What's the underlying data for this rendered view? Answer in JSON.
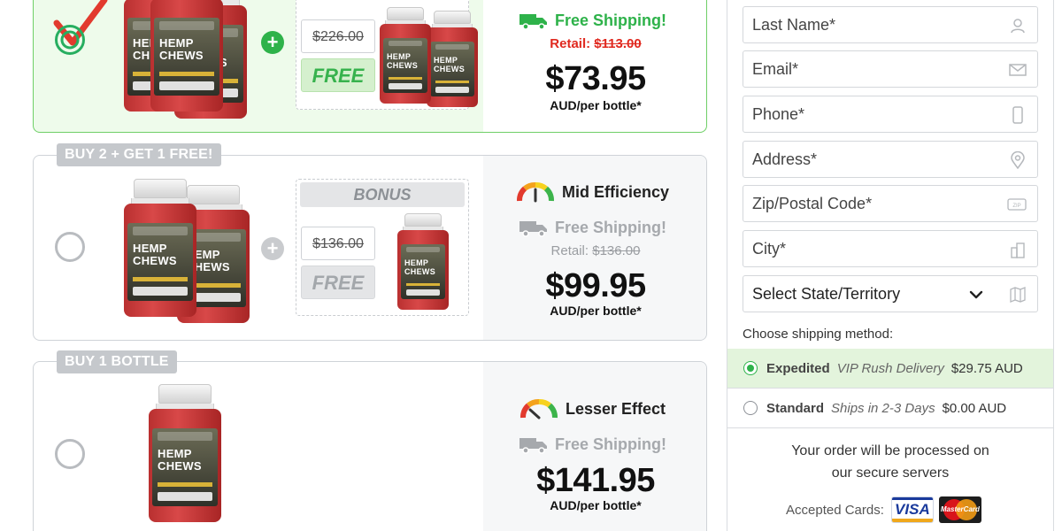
{
  "offers": [
    {
      "label": "",
      "selected": true,
      "bottle_name": "HEMP\nCHEWS",
      "bonus_header": "",
      "old_bonus_price": "$226.00",
      "free_label": "FREE",
      "efficiency": "",
      "shipping": "Free Shipping!",
      "retail_prefix": "Retail:",
      "retail_price": "$113.00",
      "price": "$73.95",
      "per": "AUD/per bottle*"
    },
    {
      "label": "BUY 2 + GET 1 FREE!",
      "selected": false,
      "bottle_name": "HEMP\nCHEWS",
      "bonus_header": "BONUS",
      "old_bonus_price": "$136.00",
      "free_label": "FREE",
      "efficiency": "Mid Efficiency",
      "shipping": "Free Shipping!",
      "retail_prefix": "Retail:",
      "retail_price": "$136.00",
      "price": "$99.95",
      "per": "AUD/per bottle*"
    },
    {
      "label": "BUY 1 BOTTLE",
      "selected": false,
      "bottle_name": "HEMP\nCHEWS",
      "efficiency": "Lesser Effect",
      "shipping": "Free Shipping!",
      "price": "$141.95",
      "per": "AUD/per bottle*"
    }
  ],
  "form": {
    "fields": [
      {
        "placeholder": "Last Name*",
        "icon": "user-icon"
      },
      {
        "placeholder": "Email*",
        "icon": "envelope-icon"
      },
      {
        "placeholder": "Phone*",
        "icon": "phone-icon"
      },
      {
        "placeholder": "Address*",
        "icon": "location-pin-icon"
      },
      {
        "placeholder": "Zip/Postal Code*",
        "icon": "zip-icon"
      },
      {
        "placeholder": "City*",
        "icon": "city-icon"
      }
    ],
    "state_select": {
      "value": "Select State/Territory",
      "icon": "map-icon"
    },
    "shipping_title": "Choose shipping method:",
    "shipping_options": [
      {
        "name": "Expedited",
        "desc": "VIP Rush Delivery",
        "price": "$29.75 AUD",
        "selected": true
      },
      {
        "name": "Standard",
        "desc": "Ships in 2-3 Days",
        "price": "$0.00 AUD",
        "selected": false
      }
    ],
    "secure_line1": "Your order will be processed on",
    "secure_line2": "our secure servers",
    "accepted_cards_label": "Accepted Cards:",
    "cards": [
      "VISA",
      "MasterCard"
    ]
  },
  "colors": {
    "accent_green": "#2eb24a",
    "retail_red": "#e0291f",
    "selected_bg": "#eefbeb"
  }
}
